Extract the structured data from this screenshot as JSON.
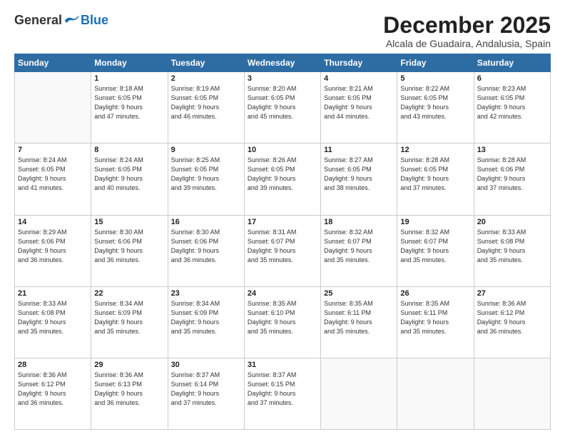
{
  "logo": {
    "general": "General",
    "blue": "Blue"
  },
  "title": "December 2025",
  "subtitle": "Alcala de Guadaira, Andalusia, Spain",
  "header_days": [
    "Sunday",
    "Monday",
    "Tuesday",
    "Wednesday",
    "Thursday",
    "Friday",
    "Saturday"
  ],
  "weeks": [
    [
      {
        "day": "",
        "info": ""
      },
      {
        "day": "1",
        "info": "Sunrise: 8:18 AM\nSunset: 6:05 PM\nDaylight: 9 hours\nand 47 minutes."
      },
      {
        "day": "2",
        "info": "Sunrise: 8:19 AM\nSunset: 6:05 PM\nDaylight: 9 hours\nand 46 minutes."
      },
      {
        "day": "3",
        "info": "Sunrise: 8:20 AM\nSunset: 6:05 PM\nDaylight: 9 hours\nand 45 minutes."
      },
      {
        "day": "4",
        "info": "Sunrise: 8:21 AM\nSunset: 6:05 PM\nDaylight: 9 hours\nand 44 minutes."
      },
      {
        "day": "5",
        "info": "Sunrise: 8:22 AM\nSunset: 6:05 PM\nDaylight: 9 hours\nand 43 minutes."
      },
      {
        "day": "6",
        "info": "Sunrise: 8:23 AM\nSunset: 6:05 PM\nDaylight: 9 hours\nand 42 minutes."
      }
    ],
    [
      {
        "day": "7",
        "info": "Sunrise: 8:24 AM\nSunset: 6:05 PM\nDaylight: 9 hours\nand 41 minutes."
      },
      {
        "day": "8",
        "info": "Sunrise: 8:24 AM\nSunset: 6:05 PM\nDaylight: 9 hours\nand 40 minutes."
      },
      {
        "day": "9",
        "info": "Sunrise: 8:25 AM\nSunset: 6:05 PM\nDaylight: 9 hours\nand 39 minutes."
      },
      {
        "day": "10",
        "info": "Sunrise: 8:26 AM\nSunset: 6:05 PM\nDaylight: 9 hours\nand 39 minutes."
      },
      {
        "day": "11",
        "info": "Sunrise: 8:27 AM\nSunset: 6:05 PM\nDaylight: 9 hours\nand 38 minutes."
      },
      {
        "day": "12",
        "info": "Sunrise: 8:28 AM\nSunset: 6:05 PM\nDaylight: 9 hours\nand 37 minutes."
      },
      {
        "day": "13",
        "info": "Sunrise: 8:28 AM\nSunset: 6:06 PM\nDaylight: 9 hours\nand 37 minutes."
      }
    ],
    [
      {
        "day": "14",
        "info": "Sunrise: 8:29 AM\nSunset: 6:06 PM\nDaylight: 9 hours\nand 36 minutes."
      },
      {
        "day": "15",
        "info": "Sunrise: 8:30 AM\nSunset: 6:06 PM\nDaylight: 9 hours\nand 36 minutes."
      },
      {
        "day": "16",
        "info": "Sunrise: 8:30 AM\nSunset: 6:06 PM\nDaylight: 9 hours\nand 36 minutes."
      },
      {
        "day": "17",
        "info": "Sunrise: 8:31 AM\nSunset: 6:07 PM\nDaylight: 9 hours\nand 35 minutes."
      },
      {
        "day": "18",
        "info": "Sunrise: 8:32 AM\nSunset: 6:07 PM\nDaylight: 9 hours\nand 35 minutes."
      },
      {
        "day": "19",
        "info": "Sunrise: 8:32 AM\nSunset: 6:07 PM\nDaylight: 9 hours\nand 35 minutes."
      },
      {
        "day": "20",
        "info": "Sunrise: 8:33 AM\nSunset: 6:08 PM\nDaylight: 9 hours\nand 35 minutes."
      }
    ],
    [
      {
        "day": "21",
        "info": "Sunrise: 8:33 AM\nSunset: 6:08 PM\nDaylight: 9 hours\nand 35 minutes."
      },
      {
        "day": "22",
        "info": "Sunrise: 8:34 AM\nSunset: 6:09 PM\nDaylight: 9 hours\nand 35 minutes."
      },
      {
        "day": "23",
        "info": "Sunrise: 8:34 AM\nSunset: 6:09 PM\nDaylight: 9 hours\nand 35 minutes."
      },
      {
        "day": "24",
        "info": "Sunrise: 8:35 AM\nSunset: 6:10 PM\nDaylight: 9 hours\nand 35 minutes."
      },
      {
        "day": "25",
        "info": "Sunrise: 8:35 AM\nSunset: 6:11 PM\nDaylight: 9 hours\nand 35 minutes."
      },
      {
        "day": "26",
        "info": "Sunrise: 8:35 AM\nSunset: 6:11 PM\nDaylight: 9 hours\nand 35 minutes."
      },
      {
        "day": "27",
        "info": "Sunrise: 8:36 AM\nSunset: 6:12 PM\nDaylight: 9 hours\nand 36 minutes."
      }
    ],
    [
      {
        "day": "28",
        "info": "Sunrise: 8:36 AM\nSunset: 6:12 PM\nDaylight: 9 hours\nand 36 minutes."
      },
      {
        "day": "29",
        "info": "Sunrise: 8:36 AM\nSunset: 6:13 PM\nDaylight: 9 hours\nand 36 minutes."
      },
      {
        "day": "30",
        "info": "Sunrise: 8:37 AM\nSunset: 6:14 PM\nDaylight: 9 hours\nand 37 minutes."
      },
      {
        "day": "31",
        "info": "Sunrise: 8:37 AM\nSunset: 6:15 PM\nDaylight: 9 hours\nand 37 minutes."
      },
      {
        "day": "",
        "info": ""
      },
      {
        "day": "",
        "info": ""
      },
      {
        "day": "",
        "info": ""
      }
    ]
  ]
}
